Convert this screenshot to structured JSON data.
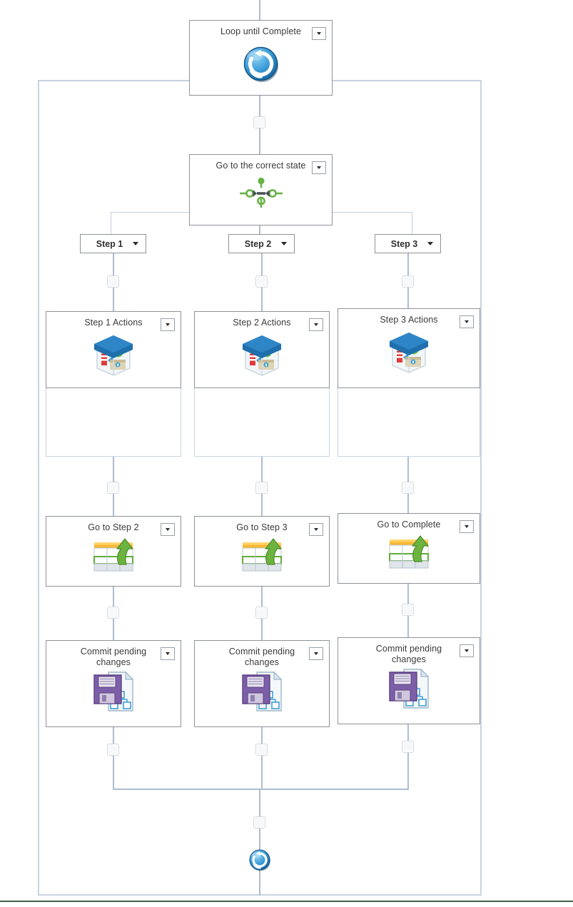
{
  "diagram": {
    "type": "workflow-flowchart",
    "title": "Loop until Complete workflow"
  },
  "loop": {
    "header_label": "Loop until Complete",
    "header_icon": "loop-refresh-icon",
    "footer_icon": "loop-refresh-small-icon",
    "dropdown_label": "▼"
  },
  "switch": {
    "label": "Go to the correct state",
    "icon": "state-switch-icon"
  },
  "branches": [
    {
      "label": "Step 1"
    },
    {
      "label": "Step 2"
    },
    {
      "label": "Step 3"
    }
  ],
  "columns": [
    {
      "actions": {
        "label": "Step 1 Actions",
        "icon": "actions-box-icon"
      },
      "goto": {
        "label": "Go to Step 2",
        "icon": "goto-table-arrow-icon"
      },
      "commit": {
        "label": "Commit pending changes",
        "icon": "save-document-icon"
      }
    },
    {
      "actions": {
        "label": "Step 2 Actions",
        "icon": "actions-box-icon"
      },
      "goto": {
        "label": "Go to Step 3",
        "icon": "goto-table-arrow-icon"
      },
      "commit": {
        "label": "Commit pending changes",
        "icon": "save-document-icon"
      }
    },
    {
      "actions": {
        "label": "Step 3 Actions",
        "icon": "actions-box-icon"
      },
      "goto": {
        "label": "Go to Complete",
        "icon": "goto-table-arrow-icon"
      },
      "commit": {
        "label": "Commit pending changes",
        "icon": "save-document-icon"
      }
    }
  ],
  "colors": {
    "connector": "#aebdd0",
    "node_border": "#8f9398",
    "container_border": "#c8d3e0",
    "loop_blue": "#2f8fd0",
    "switch_green": "#67b246",
    "goto_green": "#6cb33f",
    "goto_orange": "#f5a623",
    "save_purple": "#7c5fa8",
    "actions_blue": "#1f6fad",
    "bottom_rule": "#3f5f4a"
  }
}
